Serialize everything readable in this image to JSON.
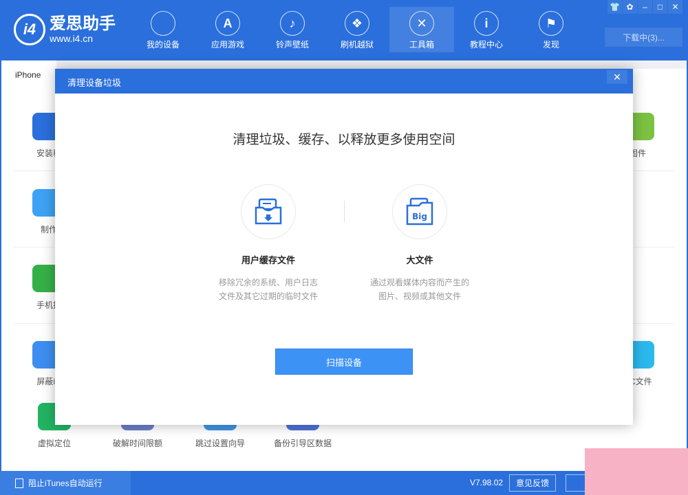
{
  "app": {
    "name": "爱思助手",
    "url": "www.i4.cn",
    "logo_text": "i4"
  },
  "nav": [
    {
      "label": "我的设备",
      "icon": "apple-icon"
    },
    {
      "label": "应用游戏",
      "icon": "appstore-icon"
    },
    {
      "label": "铃声壁纸",
      "icon": "music-icon"
    },
    {
      "label": "刷机越狱",
      "icon": "dropbox-icon"
    },
    {
      "label": "工具箱",
      "icon": "tools-icon",
      "active": true
    },
    {
      "label": "教程中心",
      "icon": "info-icon"
    },
    {
      "label": "发现",
      "icon": "flag-icon"
    }
  ],
  "window": {
    "download": "下载中(3)..."
  },
  "tab": "iPhone",
  "tools": {
    "left": [
      "安装移",
      "制作",
      "手机投",
      "屏蔽iC"
    ],
    "right": [
      "固件",
      "CC文件"
    ],
    "bottom": [
      "虚拟定位",
      "破解时间限额",
      "跳过设置向导",
      "备份引导区数据"
    ]
  },
  "modal": {
    "title": "清理设备垃圾",
    "heading": "清理垃圾、缓存、以释放更多使用空间",
    "options": [
      {
        "name": "用户缓存文件",
        "desc1": "移除冗余的系统、用户日志",
        "desc2": "文件及其它过期的临时文件",
        "icon": "inbox-download-icon"
      },
      {
        "name": "大文件",
        "desc1": "通过观看媒体内容而产生的",
        "desc2": "图片、视频或其他文件",
        "icon": "big-file-icon",
        "badge": "Big"
      }
    ],
    "scan": "扫描设备"
  },
  "footer": {
    "itunes": "阻止iTunes自动运行",
    "version": "V7.98.02",
    "feedback": "意见反馈"
  },
  "colors": {
    "primary": "#2a6fdb",
    "button": "#3d93f5"
  }
}
